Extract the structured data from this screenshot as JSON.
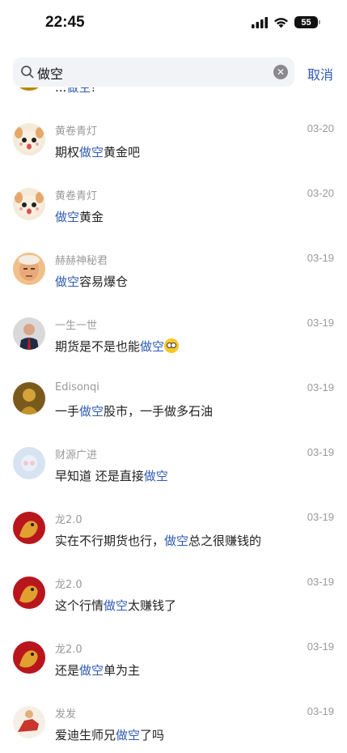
{
  "status_bar": {
    "time": "22:45",
    "battery": "55"
  },
  "search": {
    "query": "做空",
    "cancel_label": "取消"
  },
  "colors": {
    "highlight": "#2d5ab5",
    "muted": "#9a9a9a"
  },
  "results": [
    {
      "name": "",
      "date": "",
      "avatar": "gold-avatar",
      "parts": [
        {
          "t": "...",
          "h": false
        },
        {
          "t": "做空",
          "h": true
        },
        {
          "t": "!",
          "h": false
        }
      ]
    },
    {
      "name": "黄卷青灯",
      "date": "03-20",
      "avatar": "cartoon-dog-avatar",
      "parts": [
        {
          "t": "期权",
          "h": false
        },
        {
          "t": "做空",
          "h": true
        },
        {
          "t": "黄金吧",
          "h": false
        }
      ]
    },
    {
      "name": "黄卷青灯",
      "date": "03-20",
      "avatar": "cartoon-dog-avatar",
      "parts": [
        {
          "t": "做空",
          "h": true
        },
        {
          "t": "黄金",
          "h": false
        }
      ]
    },
    {
      "name": "赫赫神秘君",
      "date": "03-19",
      "avatar": "face-avatar",
      "parts": [
        {
          "t": "做空",
          "h": true
        },
        {
          "t": "容易爆仓",
          "h": false
        }
      ]
    },
    {
      "name": "一生一世",
      "date": "03-19",
      "avatar": "suit-man-avatar",
      "parts": [
        {
          "t": "期货是不是也能",
          "h": false
        },
        {
          "t": "做空",
          "h": true
        }
      ],
      "emoji": "flushed-face"
    },
    {
      "name": "Edisonqi",
      "date": "03-19",
      "avatar": "golden-statue-avatar",
      "parts": [
        {
          "t": "一手",
          "h": false
        },
        {
          "t": "做空",
          "h": true
        },
        {
          "t": "股市，一手做多石油",
          "h": false
        }
      ]
    },
    {
      "name": "财源广进",
      "date": "03-19",
      "avatar": "pale-blue-avatar",
      "parts": [
        {
          "t": "早知道 还是直接",
          "h": false
        },
        {
          "t": "做空",
          "h": true
        }
      ]
    },
    {
      "name": "龙2.0",
      "date": "03-19",
      "avatar": "red-dragon-avatar",
      "parts": [
        {
          "t": "实在不行期货也行，",
          "h": false
        },
        {
          "t": "做空",
          "h": true
        },
        {
          "t": "总之很赚钱的",
          "h": false
        }
      ]
    },
    {
      "name": "龙2.0",
      "date": "03-19",
      "avatar": "red-dragon-avatar",
      "parts": [
        {
          "t": "这个行情",
          "h": false
        },
        {
          "t": "做空",
          "h": true
        },
        {
          "t": "太赚钱了",
          "h": false
        }
      ]
    },
    {
      "name": "龙2.0",
      "date": "03-19",
      "avatar": "red-dragon-avatar",
      "parts": [
        {
          "t": "还是",
          "h": false
        },
        {
          "t": "做空",
          "h": true
        },
        {
          "t": "单为主",
          "h": false
        }
      ]
    },
    {
      "name": "发发",
      "date": "03-19",
      "avatar": "horse-avatar",
      "parts": [
        {
          "t": "爱迪生师兄",
          "h": false
        },
        {
          "t": "做空",
          "h": true
        },
        {
          "t": "了吗",
          "h": false
        }
      ]
    }
  ]
}
